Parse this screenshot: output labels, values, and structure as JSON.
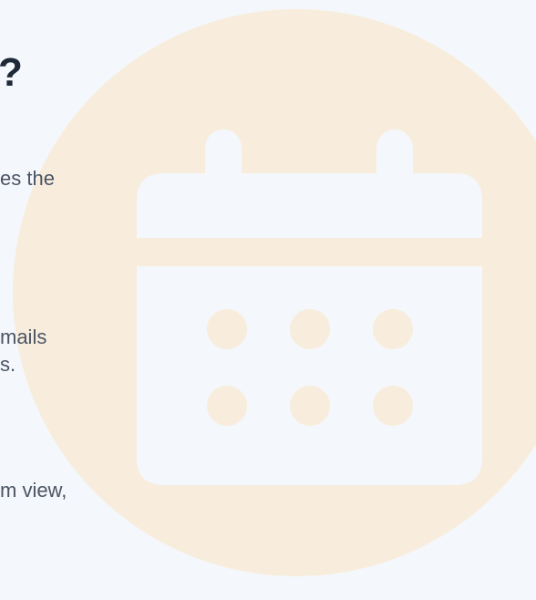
{
  "heading": {
    "fragment": "?"
  },
  "paragraphs": {
    "line_1": "es the",
    "line_2": "mails",
    "line_3": "s.",
    "line_4": "m view,"
  },
  "illustration": {
    "icon": "calendar-icon",
    "circle_color": "#f8eddc",
    "icon_color": "#f4f7fb",
    "dot_color": "#f8eddc"
  }
}
